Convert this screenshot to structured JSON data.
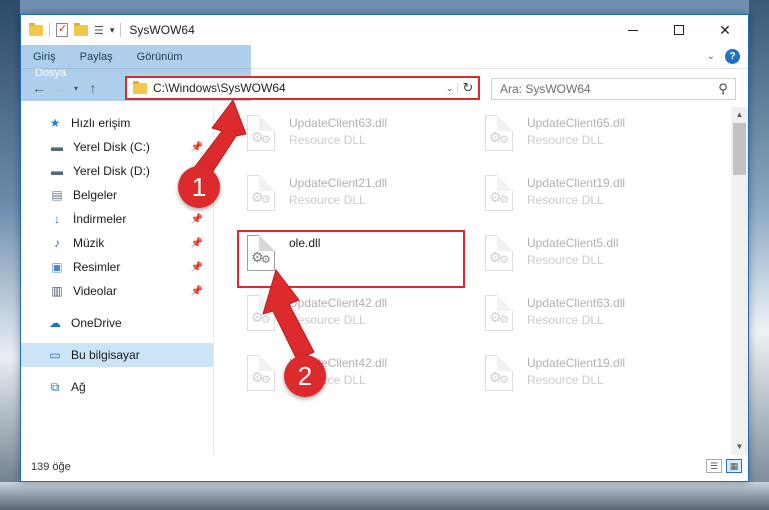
{
  "window": {
    "title": "SysWOW64",
    "minimize": "",
    "maximize": "",
    "close": "✕"
  },
  "ribbon": {
    "tabs": [
      "Dosya",
      "Giriş",
      "Paylaş",
      "Görünüm"
    ],
    "help_label": "?"
  },
  "address": {
    "path": "C:\\Windows\\SysWOW64"
  },
  "search": {
    "placeholder": "Ara: SysWOW64"
  },
  "sidebar": {
    "items": [
      {
        "label": "Hızlı erişim",
        "icon": "star-icon"
      },
      {
        "label": "Yerel Disk (C:)",
        "icon": "drive-icon",
        "pinned": true
      },
      {
        "label": "Yerel Disk (D:)",
        "icon": "drive-icon",
        "pinned": true
      },
      {
        "label": "Belgeler",
        "icon": "documents-icon",
        "pinned": true
      },
      {
        "label": "İndirmeler",
        "icon": "download-icon",
        "pinned": true
      },
      {
        "label": "Müzik",
        "icon": "music-icon",
        "pinned": true
      },
      {
        "label": "Resimler",
        "icon": "pictures-icon",
        "pinned": true
      },
      {
        "label": "Videolar",
        "icon": "videos-icon",
        "pinned": true
      },
      {
        "label": "OneDrive",
        "icon": "cloud-icon"
      },
      {
        "label": "Bu bilgisayar",
        "icon": "computer-icon",
        "selected": true
      },
      {
        "label": "Ağ",
        "icon": "network-icon"
      }
    ]
  },
  "files": [
    {
      "name": "UpdateClient63.dll",
      "type": "Resource DLL"
    },
    {
      "name": "UpdateClient65.dll",
      "type": "Resource DLL"
    },
    {
      "name": "UpdateClient21.dll",
      "type": "Resource DLL"
    },
    {
      "name": "UpdateClient19.dll",
      "type": "Resource DLL"
    },
    {
      "name": "ole.dll",
      "type": ""
    },
    {
      "name": "UpdateClient5.dll",
      "type": "Resource DLL"
    },
    {
      "name": "UpdateClient42.dll",
      "type": "Resource DLL"
    },
    {
      "name": "UpdateClient63.dll",
      "type": "Resource DLL"
    },
    {
      "name": "UpdateClient42.dll",
      "type": "Resource DLL"
    },
    {
      "name": "UpdateClient19.dll",
      "type": "Resource DLL"
    }
  ],
  "status": {
    "item_count": "139 öğe"
  },
  "annotations": {
    "step1": "1",
    "step2": "2",
    "color": "#dd2a2c"
  }
}
